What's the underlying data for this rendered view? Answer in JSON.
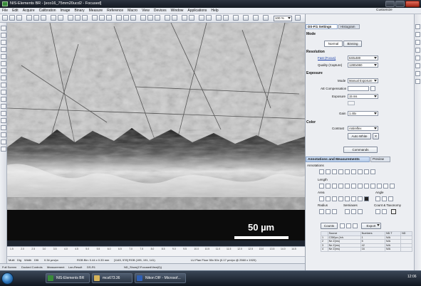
{
  "window": {
    "title": "NIS-Elements BR - [eco16_75mm20ucd2 - Focused]"
  },
  "menubar": [
    "File",
    "Edit",
    "Acquire",
    "Calibration",
    "Image",
    "Binary",
    "Measure",
    "Reference",
    "Macro",
    "View",
    "Devices",
    "Window",
    "Applications",
    "Help"
  ],
  "customize_label": "Customize",
  "zoom_value": "100 %",
  "image": {
    "scale_bar_label": "50 µm"
  },
  "ruler": {
    "ticks": [
      "1.5",
      "2.0",
      "2.5",
      "3.0",
      "3.5",
      "4.0",
      "4.5",
      "5.0",
      "5.5",
      "6.0",
      "6.5",
      "7.0",
      "7.5",
      "8.0",
      "8.5",
      "9.0",
      "9.5",
      "10.0",
      "10.5",
      "11.0",
      "11.5",
      "12.0",
      "12.5",
      "13.0",
      "13.5",
      "14.0",
      "14.5"
    ]
  },
  "status": {
    "tabs": [
      "Multi",
      "Dlg",
      "Width",
      "Dflt"
    ],
    "pixel_size": "0.34 µm/px",
    "rgb": "RGB Bin: 0.44 x 0.33 mm",
    "coords": "[1145, 578] RGB (195, 191, 141)",
    "objective": "LU Plan Fluor 50x 50x (0.17 µm/px @ 2560 x 1920)",
    "z": "Z=-115.4µm"
  },
  "doc_tabs": [
    "Full Screen",
    "Docked Controls",
    "Measurement",
    "Lan-Result",
    "DS-R1",
    "ND_Show(Z:FocusedView(0))"
  ],
  "panel": {
    "title": "DS-Fi1 Settings",
    "histogram_tab": "Histogram",
    "mode_header": "Mode",
    "mode_normal": "Normal",
    "mode_binning": "Binning",
    "resolution_header": "Resolution",
    "fast_focus_label": "Fast (Focus)",
    "fast_focus_value": "640x480",
    "quality_label": "Quality (Capture)",
    "quality_value": "1280x960",
    "exposure_header": "Exposure",
    "exp_mode_label": "Mode",
    "exp_mode_value": "Manual Exposure",
    "ae_comp_label": "AE Compensation",
    "exposure_label": "Exposure",
    "exposure_value": "15 ms",
    "gain_label": "Gain",
    "gain_value": "1.40x",
    "color_header": "Color",
    "contrast_label": "Contrast",
    "contrast_value": "Antireflex",
    "auto_white": "Auto White",
    "commands": "Commands"
  },
  "annotations": {
    "title": "Annotations and Measurements",
    "preview_tab": "Preview",
    "annotations_label": "Annotations",
    "length_label": "Length",
    "area_label": "Area",
    "angle_label": "Angle",
    "radius_label": "Radius",
    "semiaxes_label": "Semiaxes",
    "count_label": "Count & Taxonomy",
    "counts_tab": "Counts",
    "export_label": "Export",
    "columns": [
      "",
      "Source",
      "Numbers",
      "ND.T",
      "ND"
    ],
    "rows": [
      [
        "1",
        "C350px (Inh.",
        "1",
        "N/A",
        ""
      ],
      [
        "2",
        "Ne Z(ms)",
        "5",
        "N/A",
        ""
      ],
      [
        "3",
        "Ne Z(ms)",
        "42",
        "N/A",
        ""
      ],
      [
        "4",
        "Ne Z(ms)",
        "16",
        "N/A",
        ""
      ]
    ]
  },
  "taskbar": {
    "items": [
      "NIS-Elements BR",
      "mcs673.36",
      "Nikon DIF - Microsof..."
    ],
    "clock": "12:06"
  }
}
